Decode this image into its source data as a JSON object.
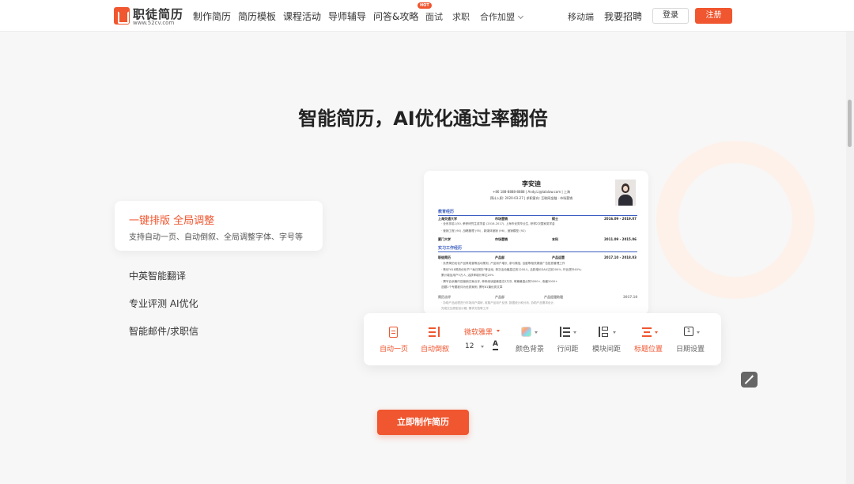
{
  "nav": {
    "logo_title": "职徒简历",
    "logo_sub": "www.52cv.com",
    "items": [
      "制作简历",
      "简历模板",
      "课程活动",
      "导师辅导",
      "问答&攻略",
      "面试",
      "求职",
      "合作加盟"
    ],
    "hot_badge": "HOT",
    "right_items": [
      "移动端",
      "我要招聘"
    ],
    "login": "登录",
    "register": "注册"
  },
  "hero": {
    "title": "智能简历，AI优化通过率翻倍"
  },
  "features": {
    "active": {
      "title": "一键排版 全局调整",
      "desc": "支持自动一页、自动倒叙、全局调整字体、字号等"
    },
    "items": [
      "中英智能翻译",
      "专业评测 AI优化",
      "智能邮件/求职信"
    ]
  },
  "resume": {
    "name": "李安迪",
    "contact": "+86 188-8888-8888  |  Andy.Li@lalalaw.com  |  上海",
    "intent": "预计入职: 2020-03-27 | 求职意向: 互联网金融 · 市场营销",
    "sections": [
      "教育经历",
      "实习工作经历"
    ],
    "edu": [
      {
        "school": "上海交通大学",
        "major": "市场营销",
        "degree": "硕士",
        "date": "2016.09 - 2019.07"
      },
      {
        "school": "厦门大学",
        "major": "市场营销",
        "degree": "本科",
        "date": "2011.09 - 2015.06"
      }
    ],
    "edu_lines": [
      "· 全系排名1/50, 荣获研究生奖学金 (2016-2017), 上海市优秀毕业生, 获得2次国家奖学金",
      "· 营销工程 (90) ,战略管理 (95) , 新媒体营销 (96) , 营销模型 (92)"
    ],
    "work": [
      {
        "company": "职徒简历",
        "role": "产品部",
        "title": "产品运营",
        "date": "2017.10 - 2018.03"
      },
      {
        "company": "简历点评",
        "role": "产品部",
        "title": "产品经理助理",
        "date": "2017.10"
      }
    ],
    "work_lines": [
      "· 负责简历优化产品养成营等活动策划, 产品用户增长, 参与微信, 百度等相关渠道广告投放管理工作",
      "· 策划\"618简历优化节\"\"每日简历\"等活动, 单次活动最高达到1200人, 活跃增长DAU达到200%, 环比提升40%;",
      "  累计增加用户5万人, 活跃率增长率达20%",
      "· 撰写百余篇内容营销文案点评, 单条阅读量最高达5万次, 单篇最高点赞3000+, 收藏2000+",
      "  选题1个专题被评为优秀案例, 撰写81篇优秀文章",
      "· 协助产品经理进行市场用户调研, 收集产品用户反馈, 数据统计和分析, 协助产品需求设计,",
      "  完成交互原型设计稿, 需求文档等工作"
    ]
  },
  "toolbar": {
    "auto_page": "自动一页",
    "auto_reverse": "自动倒叙",
    "font_name": "微软雅黑",
    "font_size": "12",
    "font_a": "A",
    "color_bg": "颜色背景",
    "line_gap": "行间距",
    "block_gap": "模块间距",
    "title_pos": "标题位置",
    "date_setting": "日期设置",
    "date_icon": "1"
  },
  "magic_icon": "magic-wand-icon",
  "cta": "立即制作简历",
  "colors": {
    "accent": "#f0562f",
    "resume_blue": "#3b5ec0"
  }
}
